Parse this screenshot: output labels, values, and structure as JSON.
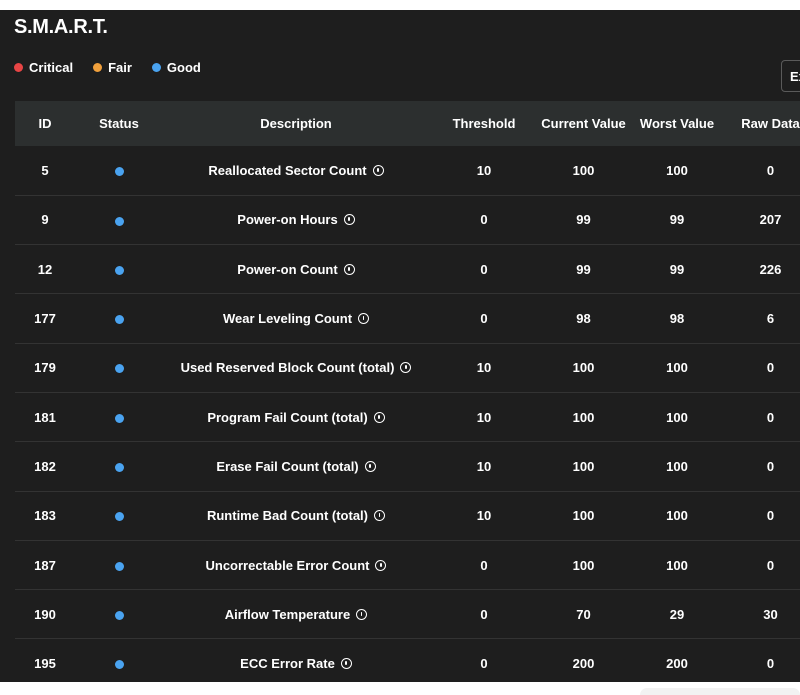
{
  "header": {
    "title": "S.M.A.R.T."
  },
  "legend": [
    {
      "label": "Critical",
      "color": "#e84545"
    },
    {
      "label": "Fair",
      "color": "#f0a03c"
    },
    {
      "label": "Good",
      "color": "#4aa3f0"
    }
  ],
  "toolbar": {
    "export_label": "Ex"
  },
  "table": {
    "columns": [
      "ID",
      "Status",
      "Description",
      "Threshold",
      "Current Value",
      "Worst Value",
      "Raw Data"
    ],
    "status_color": "#4aa3f0",
    "rows": [
      {
        "id": "5",
        "status": "Good",
        "description": "Reallocated Sector Count",
        "threshold": "10",
        "current": "100",
        "worst": "100",
        "raw": "0"
      },
      {
        "id": "9",
        "status": "Good",
        "description": "Power-on Hours",
        "threshold": "0",
        "current": "99",
        "worst": "99",
        "raw": "207"
      },
      {
        "id": "12",
        "status": "Good",
        "description": "Power-on Count",
        "threshold": "0",
        "current": "99",
        "worst": "99",
        "raw": "226"
      },
      {
        "id": "177",
        "status": "Good",
        "description": "Wear Leveling Count",
        "threshold": "0",
        "current": "98",
        "worst": "98",
        "raw": "6"
      },
      {
        "id": "179",
        "status": "Good",
        "description": "Used Reserved Block Count (total)",
        "threshold": "10",
        "current": "100",
        "worst": "100",
        "raw": "0"
      },
      {
        "id": "181",
        "status": "Good",
        "description": "Program Fail Count (total)",
        "threshold": "10",
        "current": "100",
        "worst": "100",
        "raw": "0"
      },
      {
        "id": "182",
        "status": "Good",
        "description": "Erase Fail Count (total)",
        "threshold": "10",
        "current": "100",
        "worst": "100",
        "raw": "0"
      },
      {
        "id": "183",
        "status": "Good",
        "description": "Runtime Bad Count (total)",
        "threshold": "10",
        "current": "100",
        "worst": "100",
        "raw": "0"
      },
      {
        "id": "187",
        "status": "Good",
        "description": "Uncorrectable Error Count",
        "threshold": "0",
        "current": "100",
        "worst": "100",
        "raw": "0"
      },
      {
        "id": "190",
        "status": "Good",
        "description": "Airflow Temperature",
        "threshold": "0",
        "current": "70",
        "worst": "29",
        "raw": "30"
      },
      {
        "id": "195",
        "status": "Good",
        "description": "ECC Error Rate",
        "threshold": "0",
        "current": "200",
        "worst": "200",
        "raw": "0"
      }
    ]
  }
}
